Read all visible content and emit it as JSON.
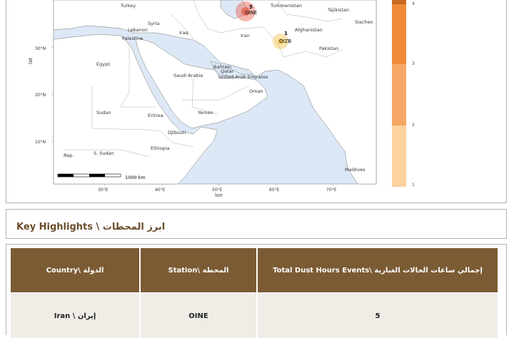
{
  "map": {
    "axis_y_label": "lat",
    "axis_x_label": "lon",
    "lat_ticks": [
      "30°N",
      "20°N",
      "10°N"
    ],
    "lon_ticks": [
      "30°E",
      "40°E",
      "50°E",
      "60°E",
      "70°E"
    ],
    "scalebar_label": "1000 km",
    "countries": [
      "Turkey",
      "Turkmenistan",
      "Syria",
      "Lebanon",
      "Palestine",
      "Iraq",
      "Iran",
      "Afghanistan",
      "Pakistan",
      "Tajikistan",
      "Siachen",
      "Egypt",
      "Bahrain",
      "Qatar",
      "Saudi Arabia",
      "United Arab Emirates",
      "Oman",
      "Sudan",
      "Eritrea",
      "Yemen",
      "Djibouti",
      "Ethiopia",
      "S. Sudan",
      "Rep.",
      "Maldives"
    ],
    "stations": [
      {
        "count": "5",
        "code": "OINE",
        "color": "#e8604c"
      },
      {
        "count": "1",
        "code": "OIZB",
        "color": "#f2c24a"
      }
    ]
  },
  "legend": {
    "ticks": [
      "4",
      "3",
      "2",
      "1"
    ],
    "colors": [
      "#c8691f",
      "#f08a3b",
      "#f6a866",
      "#fcd29e"
    ]
  },
  "highlights": {
    "title": "Key Highlights \\ ابرز المحطات"
  },
  "table": {
    "headers": [
      "Country\\ الدولة",
      "Station\\ المحطة",
      "Total Dust Hours Events\\ إجمالي ساعات الحالات الغبارية"
    ],
    "rows": [
      [
        "Iran \\ إيران",
        "OINE",
        "5"
      ]
    ]
  }
}
